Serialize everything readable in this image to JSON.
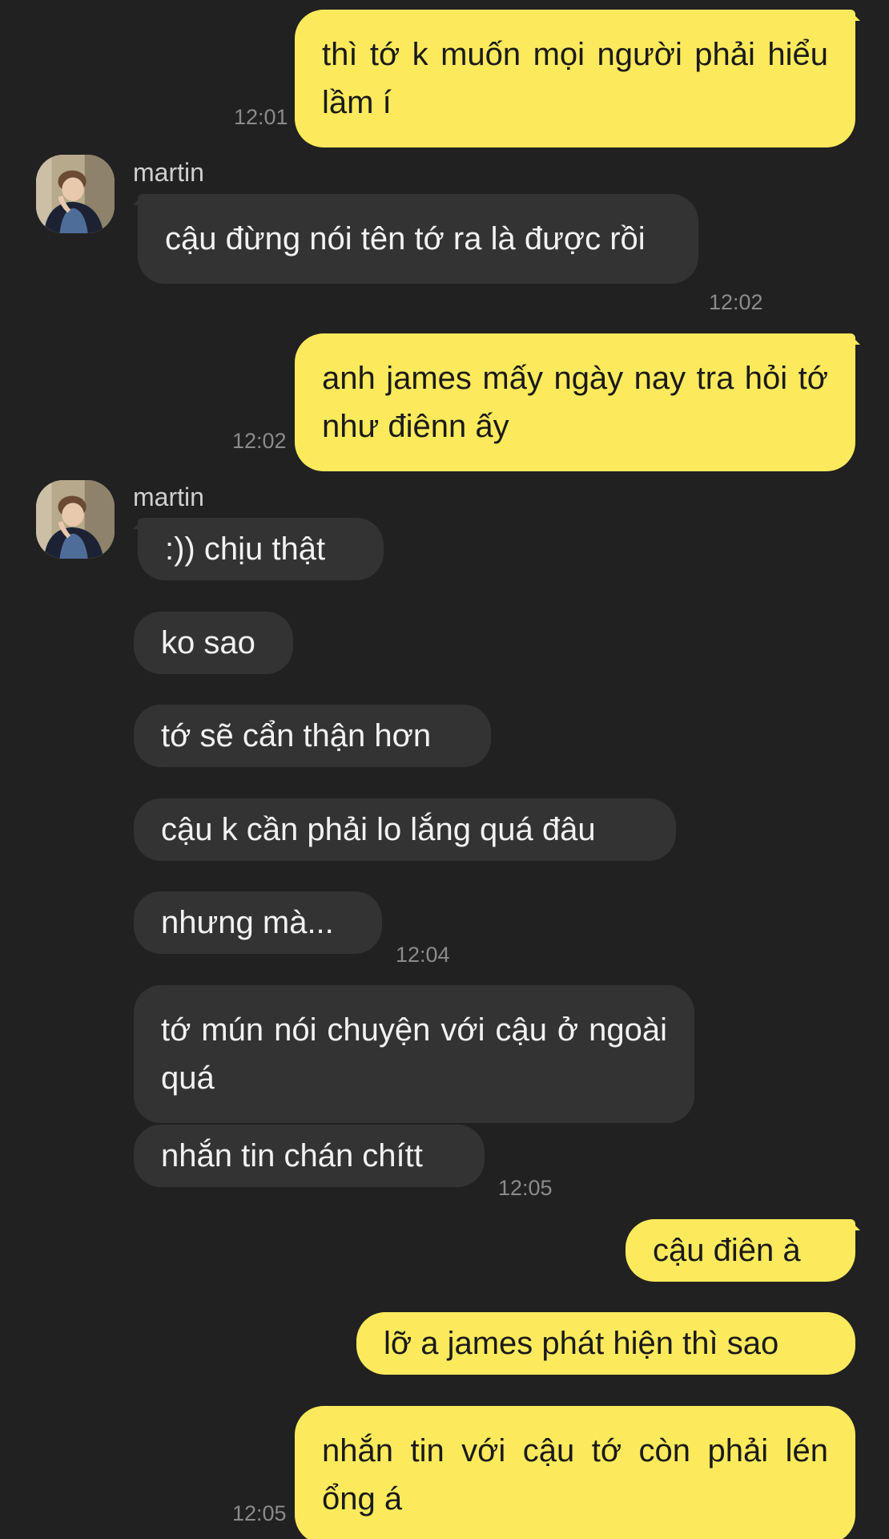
{
  "chat": {
    "messages": [
      {
        "side": "out",
        "text": "thì tớ k muốn mọi người phải hiểu lầm í",
        "time": "12:01"
      },
      {
        "side": "in",
        "sender": "martin",
        "text": "cậu đừng nói tên tớ ra là được rồi",
        "time": "12:02"
      },
      {
        "side": "out",
        "text": "anh james mấy ngày nay tra hỏi tớ như điênn ấy",
        "time": "12:02"
      },
      {
        "side": "in",
        "sender": "martin",
        "text": ":)) chịu thật"
      },
      {
        "side": "in",
        "text": "ko sao"
      },
      {
        "side": "in",
        "text": "tớ sẽ cẩn thận hơn"
      },
      {
        "side": "in",
        "text": "cậu k cần phải lo lắng quá đâu"
      },
      {
        "side": "in",
        "text": "nhưng mà...",
        "time": "12:04"
      },
      {
        "side": "in",
        "text": "tớ mún nói chuyện với cậu ở ngoài quá"
      },
      {
        "side": "in",
        "text": "nhắn tin chán chítt",
        "time": "12:05"
      },
      {
        "side": "out",
        "text": "cậu điên à"
      },
      {
        "side": "out",
        "text": "lỡ a james phát hiện thì sao"
      },
      {
        "side": "out",
        "text": "nhắn tin với cậu tớ còn phải lén ổng á",
        "time": "12:05"
      }
    ]
  },
  "colors": {
    "background": "#212121",
    "outgoing_bubble": "#fcea5c",
    "incoming_bubble": "#333333"
  }
}
